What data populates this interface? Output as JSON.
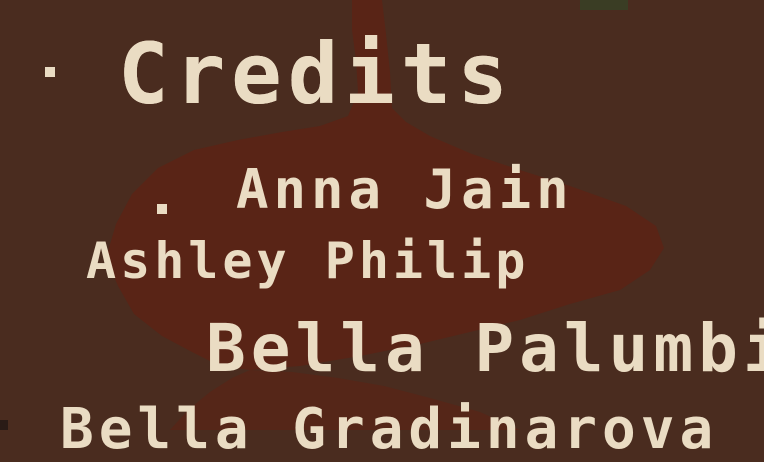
{
  "scene": {
    "title": "Credits",
    "names": [
      "Anna Jain",
      "Ashley Philip",
      "Bella Palumbi",
      "Bella Gradinarova"
    ]
  },
  "colors": {
    "background": "#4a2c1f",
    "path": "#5a2416",
    "text": "#eadcc3",
    "corner_block": "#3a3d24"
  }
}
